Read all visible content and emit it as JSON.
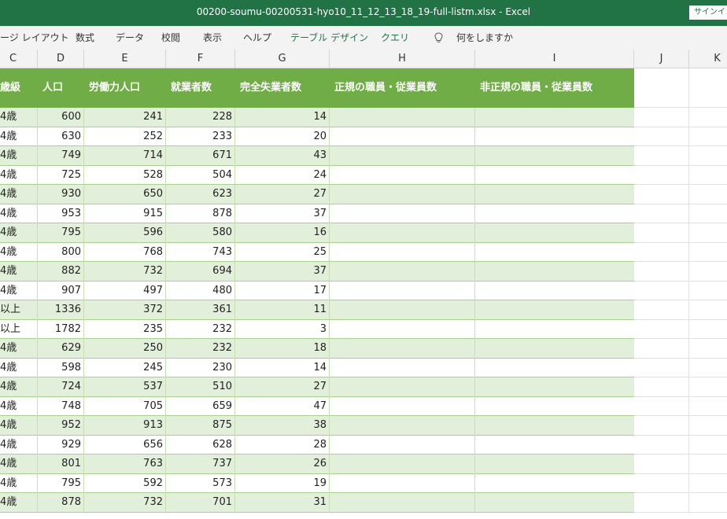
{
  "window": {
    "title": "00200-soumu-00200531-hyo10_11_12_13_18_19-full-listm.xlsx  -  Excel",
    "signin_label": "サインイン"
  },
  "ribbon": {
    "tabs": [
      "ージ レイアウト",
      "数式",
      "データ",
      "校閲",
      "表示",
      "ヘルプ",
      "テーブル デザイン",
      "クエリ"
    ],
    "tell_me": "何をしますか",
    "icon": "lightbulb-icon"
  },
  "columns": [
    "C",
    "D",
    "E",
    "F",
    "G",
    "H",
    "I",
    "J",
    "K"
  ],
  "table": {
    "headers": [
      "歳級",
      "人口",
      "労働力人口",
      "就業者数",
      "完全失業者数",
      "正規の職員・従業員数",
      "非正規の職員・従業員数"
    ],
    "rows": [
      [
        "4歳",
        "600",
        "241",
        "228",
        "14"
      ],
      [
        "4歳",
        "630",
        "252",
        "233",
        "20"
      ],
      [
        "4歳",
        "749",
        "714",
        "671",
        "43"
      ],
      [
        "4歳",
        "725",
        "528",
        "504",
        "24"
      ],
      [
        "4歳",
        "930",
        "650",
        "623",
        "27"
      ],
      [
        "4歳",
        "953",
        "915",
        "878",
        "37"
      ],
      [
        "4歳",
        "795",
        "596",
        "580",
        "16"
      ],
      [
        "4歳",
        "800",
        "768",
        "743",
        "25"
      ],
      [
        "4歳",
        "882",
        "732",
        "694",
        "37"
      ],
      [
        "4歳",
        "907",
        "497",
        "480",
        "17"
      ],
      [
        "以上",
        "1336",
        "372",
        "361",
        "11"
      ],
      [
        "以上",
        "1782",
        "235",
        "232",
        "3"
      ],
      [
        "4歳",
        "629",
        "250",
        "232",
        "18"
      ],
      [
        "4歳",
        "598",
        "245",
        "230",
        "14"
      ],
      [
        "4歳",
        "724",
        "537",
        "510",
        "27"
      ],
      [
        "4歳",
        "748",
        "705",
        "659",
        "47"
      ],
      [
        "4歳",
        "952",
        "913",
        "875",
        "38"
      ],
      [
        "4歳",
        "929",
        "656",
        "628",
        "28"
      ],
      [
        "4歳",
        "801",
        "763",
        "737",
        "26"
      ],
      [
        "4歳",
        "795",
        "592",
        "573",
        "19"
      ],
      [
        "4歳",
        "878",
        "732",
        "701",
        "31"
      ]
    ]
  },
  "colors": {
    "excel_green": "#217346",
    "table_header": "#70ad47",
    "band_light": "#e2efda"
  }
}
